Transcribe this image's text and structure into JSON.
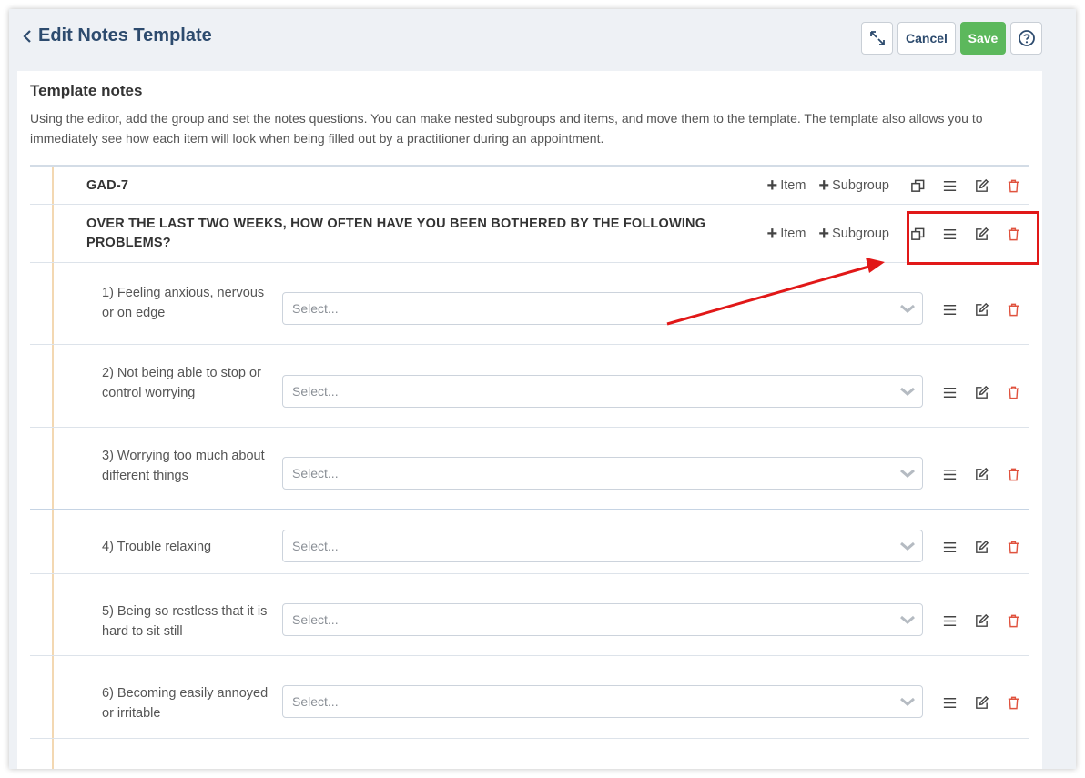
{
  "header": {
    "title": "Edit Notes Template",
    "cancel_label": "Cancel",
    "save_label": "Save",
    "save_color": "#5cb85c"
  },
  "panel": {
    "title": "Template notes",
    "description": "Using the editor, add the group and set the notes questions. You can make nested subgroups and items, and move them to the template. The template also allows you to immediately see how each item will look when being filled out by a practitioner during an appointment."
  },
  "actions": {
    "item_label": "Item",
    "subgroup_label": "Subgroup"
  },
  "groups": [
    {
      "title": "GAD-7"
    },
    {
      "title": "OVER THE LAST TWO WEEKS, HOW OFTEN HAVE YOU BEEN BOTHERED BY THE FOLLOWING PROBLEMS?"
    }
  ],
  "questions": [
    {
      "label": "1) Feeling anxious, nervous or on edge",
      "placeholder": "Select..."
    },
    {
      "label": "2) Not being able to stop or control worrying",
      "placeholder": "Select..."
    },
    {
      "label": "3) Worrying too much about different things",
      "placeholder": "Select..."
    },
    {
      "label": "4) Trouble relaxing",
      "placeholder": "Select..."
    },
    {
      "label": "5) Being so restless that it is hard to sit still",
      "placeholder": "Select..."
    },
    {
      "label": "6) Becoming easily annoyed or irritable",
      "placeholder": "Select..."
    }
  ],
  "annotation": {
    "highlight_color": "#e11818",
    "target": "group action icons"
  },
  "icons": [
    "chevron-left-icon",
    "expand-icon",
    "help-icon",
    "plus-icon",
    "copy-icon",
    "drag-handle-icon",
    "edit-icon",
    "trash-icon",
    "chevron-down-icon"
  ]
}
